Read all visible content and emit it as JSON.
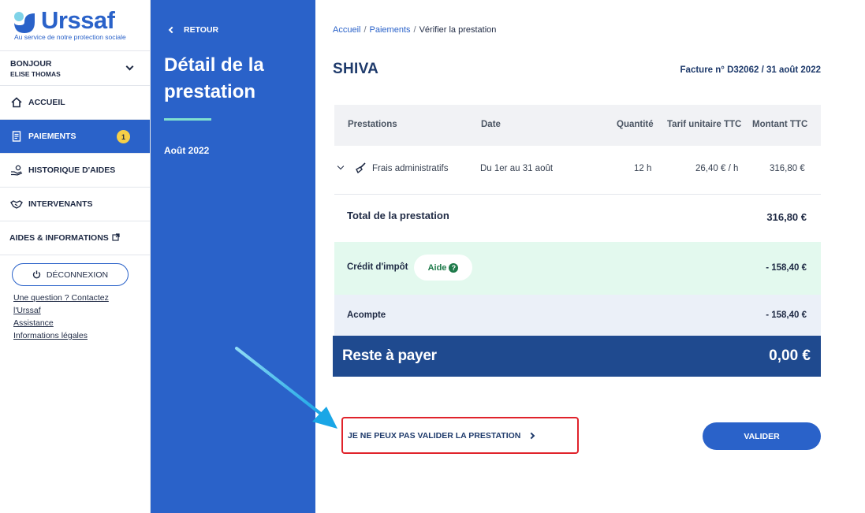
{
  "brand": {
    "name": "Urssaf",
    "tagline": "Au service de notre protection sociale",
    "colors": {
      "primary": "#2a62c9",
      "dark": "#1f4a8f",
      "credit_bg": "#e3f9ee",
      "badge": "#f6cf47",
      "highlight": "#e0232b"
    }
  },
  "sidebar": {
    "greeting": {
      "line1": "BONJOUR",
      "line2": "ELISE THOMAS",
      "icon": "chevron-down-icon"
    },
    "items": [
      {
        "label": "ACCUEIL",
        "icon": "home-icon"
      },
      {
        "label": "PAIEMENTS",
        "icon": "receipt-icon",
        "badge": "1",
        "active": true
      },
      {
        "label": "HISTORIQUE D'AIDES",
        "icon": "hand-coins-icon"
      },
      {
        "label": "INTERVENANTS",
        "icon": "handshake-icon"
      },
      {
        "label": "AIDES & INFORMATIONS",
        "icon": "external-link-icon"
      }
    ],
    "logout_label": "DÉCONNEXION",
    "links": [
      "Une question ? Contactez",
      "l'Urssaf",
      "Assistance",
      "Informations légales"
    ]
  },
  "panel": {
    "back_label": "RETOUR",
    "title": "Détail de la prestation",
    "period": "Août 2022"
  },
  "breadcrumb": {
    "items": [
      "Accueil",
      "Paiements"
    ],
    "current": "Vérifier la prestation",
    "separator": "/"
  },
  "header": {
    "provider": "SHIVA",
    "invoice": "Facture n° D32062 / 31 août 2022"
  },
  "table": {
    "columns": [
      "Prestations",
      "Date",
      "Quantité",
      "Tarif unitaire TTC",
      "Montant TTC"
    ],
    "rows": [
      {
        "prestation": "Frais administratifs",
        "date": "Du 1er au 31 août",
        "quantite": "12 h",
        "tarif": "26,40 € / h",
        "montant": "316,80 €",
        "icon": "broom-icon"
      }
    ]
  },
  "summary": {
    "total_label": "Total de la prestation",
    "total_value": "316,80 €",
    "credit_label": "Crédit d'impôt",
    "credit_help": "Aide",
    "credit_value": "- 158,40 €",
    "acompte_label": "Acompte",
    "acompte_value": "- 158,40 €",
    "reste_label": "Reste à payer",
    "reste_value": "0,00 €"
  },
  "actions": {
    "cannot_validate": "JE NE PEUX PAS VALIDER LA PRESTATION",
    "validate": "VALIDER"
  }
}
